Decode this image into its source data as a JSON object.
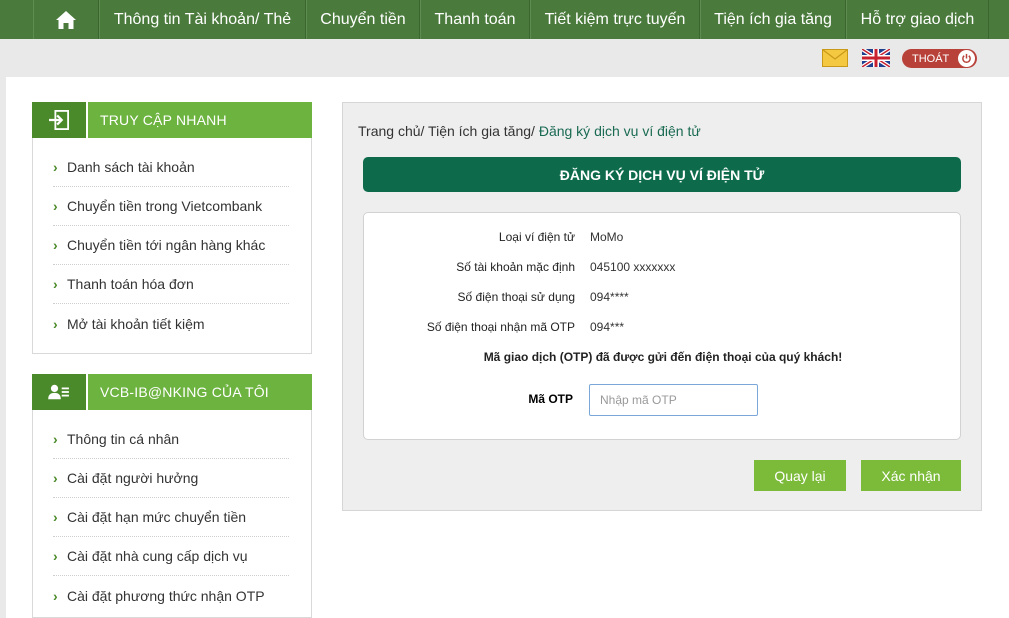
{
  "nav": {
    "home_icon": "home-icon",
    "items": [
      "Thông tin Tài khoản/ Thẻ",
      "Chuyển tiền",
      "Thanh toán",
      "Tiết kiệm trực tuyến",
      "Tiện ích gia tăng",
      "Hỗ trợ giao dịch"
    ]
  },
  "utility": {
    "mail_icon": "mail-icon",
    "flag_icon": "uk-flag-icon",
    "logout_label": "THOÁT",
    "power_icon": "power-icon"
  },
  "quick_access": {
    "title": "TRUY CẬP NHANH",
    "icon": "sign-in-icon",
    "items": [
      "Danh sách tài khoản",
      "Chuyển tiền trong Vietcombank",
      "Chuyển tiền tới ngân hàng khác",
      "Thanh toán hóa đơn",
      "Mở tài khoản tiết kiệm"
    ]
  },
  "my_ibanking": {
    "title": "VCB-IB@NKING CỦA TÔI",
    "icon": "user-card-icon",
    "items": [
      "Thông tin cá nhân",
      "Cài đặt người hưởng",
      "Cài đặt hạn mức chuyển tiền",
      "Cài đặt nhà cung cấp dịch vụ",
      "Cài đặt phương thức nhận OTP"
    ]
  },
  "breadcrumb": {
    "home": "Trang chủ",
    "sep1": "/",
    "section": "Tiện ích gia tăng",
    "sep2": "/",
    "current": "Đăng ký dịch vụ ví điện tử"
  },
  "form": {
    "title": "ĐĂNG KÝ DỊCH VỤ VÍ ĐIỆN TỬ",
    "rows": [
      {
        "label": "Loại ví điện tử",
        "value": "MoMo"
      },
      {
        "label": "Số tài khoản mặc định",
        "value": "045100  xxxxxxx"
      },
      {
        "label": "Số điện thoại sử dụng",
        "value": "094****"
      },
      {
        "label": "Số điện thoại nhận mã OTP",
        "value": "094***"
      }
    ],
    "notice": "Mã giao dịch (OTP) đã được gửi đến điện thoại của quý khách!",
    "otp_label": "Mã OTP",
    "otp_placeholder": "Nhập mã OTP",
    "otp_value": "",
    "back_label": "Quay lại",
    "confirm_label": "Xác nhận"
  },
  "colors": {
    "nav_bg": "#4a7a3c",
    "sidebar_accent": "#6db33f",
    "title_bar": "#0d6b4c",
    "button": "#7cbb3a",
    "logout": "#b8423a"
  }
}
